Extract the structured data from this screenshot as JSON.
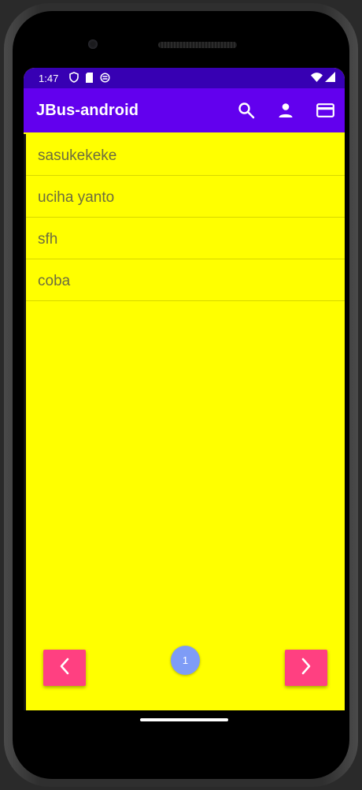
{
  "status_bar": {
    "time": "1:47",
    "icons": [
      "shield-icon",
      "sim-card-icon",
      "sync-icon"
    ],
    "right_icons": [
      "wifi-icon",
      "cell-signal-icon"
    ]
  },
  "app_bar": {
    "title": "JBus-android",
    "actions": [
      "search-icon",
      "account-icon",
      "payment-card-icon"
    ]
  },
  "list": {
    "items": [
      {
        "label": "sasukekeke"
      },
      {
        "label": "uciha yanto"
      },
      {
        "label": "sfh"
      },
      {
        "label": "coba"
      }
    ]
  },
  "pagination": {
    "page": "1",
    "prev_icon": "chevron-left-icon",
    "next_icon": "chevron-right-icon"
  },
  "colors": {
    "status_bar": "#3700b3",
    "app_bar": "#6200ee",
    "background": "#ffff00",
    "nav_button": "#ff4081",
    "page_badge": "#7e9cf6",
    "list_text": "#6d6d40"
  }
}
